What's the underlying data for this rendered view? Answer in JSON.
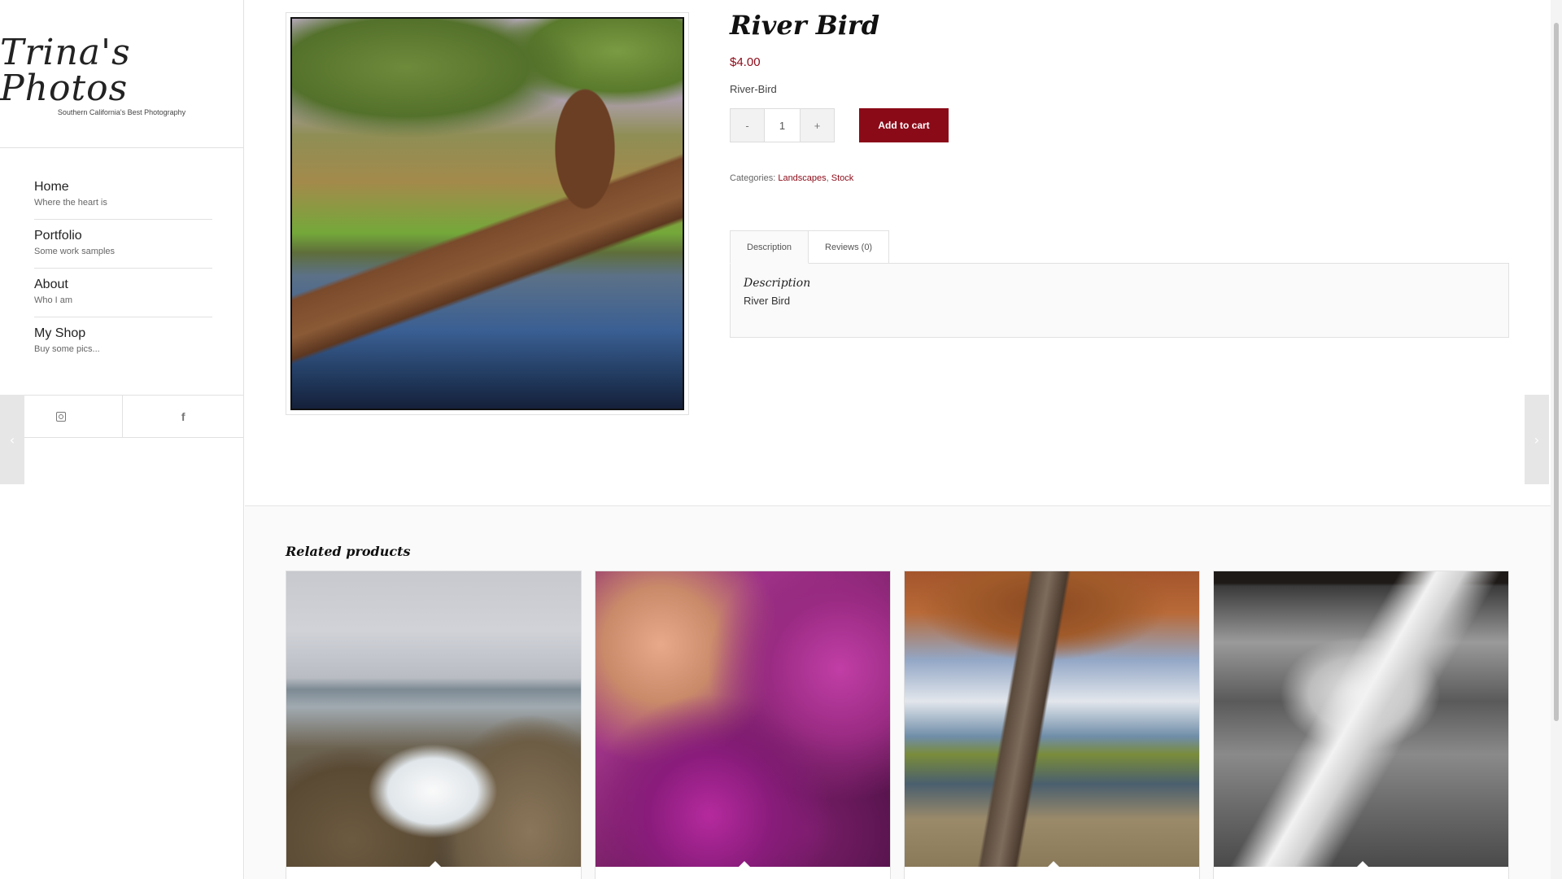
{
  "site": {
    "logo_title": "Trina's Photos",
    "logo_tagline": "Southern California's Best Photography"
  },
  "nav": {
    "items": [
      {
        "label": "Home",
        "sub": "Where the heart is"
      },
      {
        "label": "Portfolio",
        "sub": "Some work samples"
      },
      {
        "label": "About",
        "sub": "Who I am"
      },
      {
        "label": "My Shop",
        "sub": "Buy some pics..."
      }
    ]
  },
  "social": {
    "icons": [
      "instagram-icon",
      "facebook-icon"
    ],
    "facebook_glyph": "f"
  },
  "arrows": {
    "prev": "‹",
    "next": "›"
  },
  "product": {
    "title": "River Bird",
    "price": "$4.00",
    "sku": "River-Bird",
    "qty_minus": "-",
    "qty_value": "1",
    "qty_plus": "+",
    "add_to_cart": "Add to cart",
    "categories_label": "Categories:",
    "categories": [
      "Landscapes",
      "Stock"
    ],
    "category_separator": ",",
    "image_description": "tree over reflective river with bird"
  },
  "tabs": {
    "items": [
      "Description",
      "Reviews (0)"
    ],
    "active": "Description",
    "panel_heading": "Description",
    "panel_text": "River Bird"
  },
  "related": {
    "title": "Related products",
    "products": [
      {
        "image": "rocky coastline with crashing waves"
      },
      {
        "image": "purple starfish cluster"
      },
      {
        "image": "autumn tree by lake with bench"
      },
      {
        "image": "black and white wooded path with fence"
      }
    ]
  },
  "colors": {
    "accent": "#8b0a18",
    "text": "#333333",
    "border": "#e1e1e1"
  }
}
